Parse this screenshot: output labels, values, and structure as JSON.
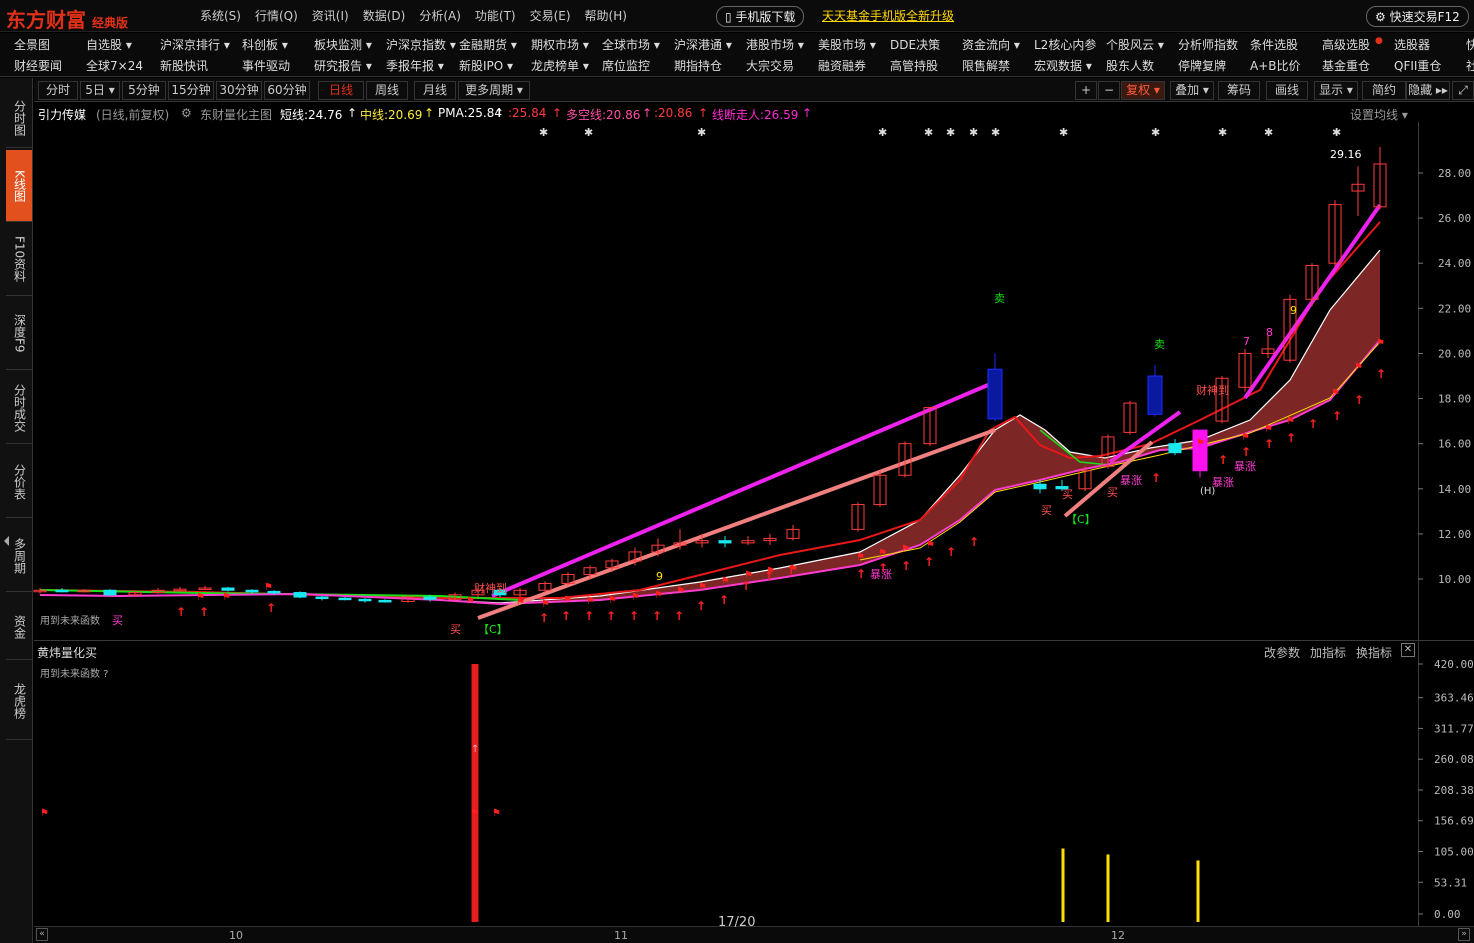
{
  "app": {
    "logo": "东方财富",
    "edition": "经典版",
    "menu": [
      "系统(S)",
      "行情(Q)",
      "资讯(I)",
      "数据(D)",
      "分析(A)",
      "功能(T)",
      "交易(E)",
      "帮助(H)"
    ],
    "mobile_download": "手机版下载",
    "fund_ad": "天天基金手机版全新升级",
    "quick_trade": "快速交易F12"
  },
  "nav_row1": [
    "全景图",
    "自选股 ▾",
    "沪深京排行 ▾",
    "科创板 ▾",
    "板块监测 ▾",
    "沪深京指数 ▾",
    "金融期货 ▾",
    "期权市场 ▾",
    "全球市场 ▾",
    "沪深港通 ▾",
    "港股市场 ▾",
    "美股市场 ▾",
    "DDE决策",
    "资金流向 ▾",
    "L2核心内参",
    "个股风云 ▾",
    "分析师指数",
    "条件选股",
    "高级选股",
    "选股器",
    "快"
  ],
  "nav_row2": [
    "财经要闻",
    "全球7×24",
    "新股快讯",
    "事件驱动",
    "研究报告 ▾",
    "季报年报 ▾",
    "新股IPO ▾",
    "龙虎榜单 ▾",
    "席位监控",
    "期指持仓",
    "大宗交易",
    "融资融券",
    "高管持股",
    "限售解禁",
    "宏观数据 ▾",
    "股东人数",
    "停牌复牌",
    "A+B比价",
    "基金重仓",
    "QFII重仓",
    "社"
  ],
  "sidebar_tabs": [
    "分时图",
    "K线图",
    "F10资料",
    "深度F9",
    "分时成交",
    "分价表",
    "多周期",
    "资金",
    "龙虎榜"
  ],
  "periods": [
    "分时",
    "5日 ▾",
    "5分钟",
    "15分钟",
    "30分钟",
    "60分钟",
    "日线",
    "周线",
    "月线",
    "更多周期 ▾"
  ],
  "active_period": "日线",
  "tools": [
    "+",
    "−",
    "复权 ▾",
    "叠加 ▾",
    "筹码",
    "画线",
    "显示 ▾",
    "简约",
    "隐藏 ▸▸",
    "⤢"
  ],
  "indicator": {
    "stock": "引力传媒",
    "mode": "(日线,前复权)",
    "main_chart": "东财量化主图",
    "short_line": "短线:24.76",
    "mid_line": "中线:20.69",
    "pma": "PMA:25.84",
    "v1": ":25.84",
    "multi_empty": "多空线:20.86",
    "v2": ":20.86",
    "line_break": "线断走人:26.59",
    "settings": "设置均线 ▾"
  },
  "upper_chart": {
    "y_ticks": [
      "28.00",
      "26.00",
      "24.00",
      "22.00",
      "20.00",
      "18.00",
      "16.00",
      "14.00",
      "12.00",
      "10.00"
    ],
    "high_label": "29.16",
    "note": "用到未来函数",
    "buy": "买",
    "sell": "卖",
    "surge": "暴涨",
    "caishen": "财神到",
    "c_label": "【C】",
    "h_label": "(H)",
    "seven": "7",
    "eight": "8",
    "nine": "9"
  },
  "lower_chart": {
    "title": "黄炜量化买",
    "note": "用到未来函数 ?",
    "actions": [
      "改参数",
      "加指标",
      "换指标"
    ],
    "close": "✕",
    "y_ticks": [
      "420.00",
      "363.46",
      "311.77",
      "260.08",
      "208.38",
      "156.69",
      "105.00",
      "53.31",
      "0.00"
    ]
  },
  "bottom": {
    "page": "17/20",
    "months": [
      "10",
      "11",
      "12"
    ]
  },
  "chart_data": {
    "type": "candlestick",
    "title": "引力传媒",
    "ylim": [
      9,
      29.5
    ],
    "x": [
      "10",
      "11",
      "12"
    ],
    "candles": [
      {
        "o": 9.45,
        "c": 9.5,
        "h": 9.6,
        "l": 9.35
      },
      {
        "o": 9.5,
        "c": 9.45,
        "h": 9.6,
        "l": 9.4
      },
      {
        "o": 9.45,
        "c": 9.5,
        "h": 9.55,
        "l": 9.4
      },
      {
        "o": 9.5,
        "c": 9.3,
        "h": 9.55,
        "l": 9.25
      },
      {
        "o": 9.3,
        "c": 9.4,
        "h": 9.5,
        "l": 9.25
      },
      {
        "o": 9.4,
        "c": 9.5,
        "h": 9.6,
        "l": 9.35
      },
      {
        "o": 9.5,
        "c": 9.55,
        "h": 9.65,
        "l": 9.45
      },
      {
        "o": 9.55,
        "c": 9.6,
        "h": 9.7,
        "l": 9.5
      },
      {
        "o": 9.6,
        "c": 9.5,
        "h": 9.65,
        "l": 9.45
      },
      {
        "o": 9.5,
        "c": 9.45,
        "h": 9.55,
        "l": 9.35
      },
      {
        "o": 9.45,
        "c": 9.4,
        "h": 9.5,
        "l": 9.3
      },
      {
        "o": 9.4,
        "c": 9.2,
        "h": 9.45,
        "l": 9.15
      },
      {
        "o": 9.2,
        "c": 9.15,
        "h": 9.25,
        "l": 9.05
      },
      {
        "o": 9.15,
        "c": 9.1,
        "h": 9.2,
        "l": 9.05
      },
      {
        "o": 9.1,
        "c": 9.05,
        "h": 9.15,
        "l": 8.95
      },
      {
        "o": 9.05,
        "c": 9.0,
        "h": 9.1,
        "l": 8.95
      },
      {
        "o": 9.0,
        "c": 9.2,
        "h": 9.3,
        "l": 8.95
      },
      {
        "o": 9.2,
        "c": 9.1,
        "h": 9.3,
        "l": 9.0
      },
      {
        "o": 9.1,
        "c": 9.3,
        "h": 9.4,
        "l": 9.05
      },
      {
        "o": 9.3,
        "c": 9.5,
        "h": 9.6,
        "l": 9.2
      },
      {
        "o": 9.5,
        "c": 9.3,
        "h": 9.6,
        "l": 9.2
      },
      {
        "o": 9.3,
        "c": 9.5,
        "h": 9.6,
        "l": 9.2
      },
      {
        "o": 9.5,
        "c": 9.8,
        "h": 9.9,
        "l": 9.4
      },
      {
        "o": 9.8,
        "c": 10.2,
        "h": 10.3,
        "l": 9.7
      },
      {
        "o": 10.2,
        "c": 10.5,
        "h": 10.6,
        "l": 10.0
      },
      {
        "o": 10.5,
        "c": 10.8,
        "h": 10.9,
        "l": 10.3
      },
      {
        "o": 10.8,
        "c": 11.2,
        "h": 11.4,
        "l": 10.6
      },
      {
        "o": 11.2,
        "c": 11.5,
        "h": 11.8,
        "l": 11.0
      },
      {
        "o": 11.5,
        "c": 11.6,
        "h": 12.2,
        "l": 11.3
      },
      {
        "o": 11.6,
        "c": 11.7,
        "h": 12.0,
        "l": 11.4
      },
      {
        "o": 11.7,
        "c": 11.6,
        "h": 11.9,
        "l": 11.4
      },
      {
        "o": 11.6,
        "c": 11.7,
        "h": 11.9,
        "l": 11.5
      },
      {
        "o": 11.7,
        "c": 11.8,
        "h": 12.0,
        "l": 11.5
      },
      {
        "o": 11.8,
        "c": 12.2,
        "h": 12.4,
        "l": 11.7
      },
      {
        "o": 12.2,
        "c": 13.3,
        "h": 13.4,
        "l": 12.1
      },
      {
        "o": 13.3,
        "c": 14.6,
        "h": 14.8,
        "l": 13.2
      },
      {
        "o": 14.6,
        "c": 16.0,
        "h": 16.1,
        "l": 14.5
      },
      {
        "o": 16.0,
        "c": 17.6,
        "h": 17.6,
        "l": 15.9
      },
      {
        "o": 19.3,
        "c": 17.1,
        "h": 20.0,
        "l": 17.0
      },
      {
        "o": 14.2,
        "c": 14.0,
        "h": 14.4,
        "l": 13.8
      },
      {
        "o": 14.1,
        "c": 14.0,
        "h": 14.4,
        "l": 13.9
      },
      {
        "o": 14.0,
        "c": 14.8,
        "h": 15.0,
        "l": 13.9
      },
      {
        "o": 15.0,
        "c": 16.3,
        "h": 16.4,
        "l": 14.9
      },
      {
        "o": 16.5,
        "c": 17.8,
        "h": 17.9,
        "l": 16.4
      },
      {
        "o": 19.0,
        "c": 17.3,
        "h": 19.5,
        "l": 17.2
      },
      {
        "o": 16.0,
        "c": 15.6,
        "h": 16.2,
        "l": 15.5
      },
      {
        "o": 15.5,
        "c": 15.2,
        "h": 16.6,
        "l": 14.5
      },
      {
        "o": 16.6,
        "c": 14.8,
        "h": 16.6,
        "l": 14.5
      },
      {
        "o": 17.0,
        "c": 18.9,
        "h": 19.0,
        "l": 16.9
      },
      {
        "o": 18.5,
        "c": 20.0,
        "h": 20.2,
        "l": 18.3
      },
      {
        "o": 20.0,
        "c": 20.2,
        "h": 20.8,
        "l": 19.8
      },
      {
        "o": 19.7,
        "c": 22.4,
        "h": 22.6,
        "l": 19.6
      },
      {
        "o": 22.4,
        "c": 23.9,
        "h": 24.0,
        "l": 22.1
      },
      {
        "o": 24.0,
        "c": 26.6,
        "h": 26.8,
        "l": 23.8
      },
      {
        "o": 27.2,
        "c": 27.5,
        "h": 28.3,
        "l": 26.1
      },
      {
        "o": 26.5,
        "c": 28.4,
        "h": 29.16,
        "l": 26.4
      }
    ],
    "volume_indicator": {
      "name": "黄炜量化买",
      "ylim": [
        0,
        420
      ],
      "bars": [
        {
          "at": 0.33,
          "value": 420,
          "color": "#e81d1d"
        },
        {
          "at": 0.74,
          "value": 110,
          "color": "#ffe000"
        },
        {
          "at": 0.77,
          "value": 100,
          "color": "#ffe000"
        },
        {
          "at": 0.83,
          "value": 90,
          "color": "#ffe000"
        }
      ]
    }
  }
}
